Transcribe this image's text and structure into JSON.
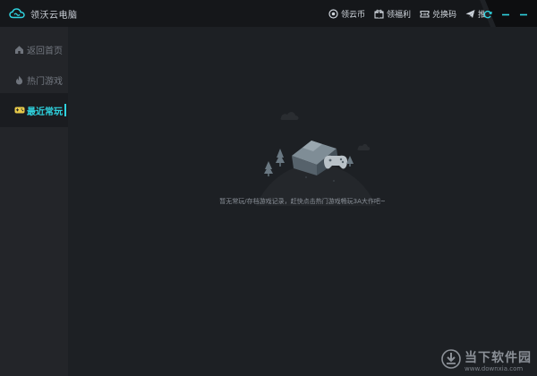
{
  "app": {
    "title": "领沃云电脑"
  },
  "top_actions": [
    {
      "label": "领云币",
      "icon": "coin-icon"
    },
    {
      "label": "领福利",
      "icon": "gift-icon"
    },
    {
      "label": "兑换码",
      "icon": "ticket-icon"
    },
    {
      "label": "推广员",
      "icon": "paper-plane-icon"
    }
  ],
  "window_controls": {
    "refresh": "refresh-icon",
    "minimize": "minimize-icon",
    "close": "close-icon"
  },
  "sidebar": {
    "items": [
      {
        "label": "返回首页",
        "icon": "home-icon",
        "active": false
      },
      {
        "label": "热门游戏",
        "icon": "flame-icon",
        "active": false
      },
      {
        "label": "最近常玩",
        "icon": "gamepad-icon",
        "active": true
      }
    ]
  },
  "main": {
    "empty_message": "暂无常玩/存档游戏记录，赶快点击热门游戏畅玩3A大作吧~"
  },
  "watermark": {
    "name": "当下软件园",
    "url": "www.downxia.com"
  },
  "colors": {
    "accent": "#2fd3df",
    "titlebar_bg": "#15171a",
    "sidebar_bg": "#232529",
    "main_bg": "#1d2024"
  }
}
